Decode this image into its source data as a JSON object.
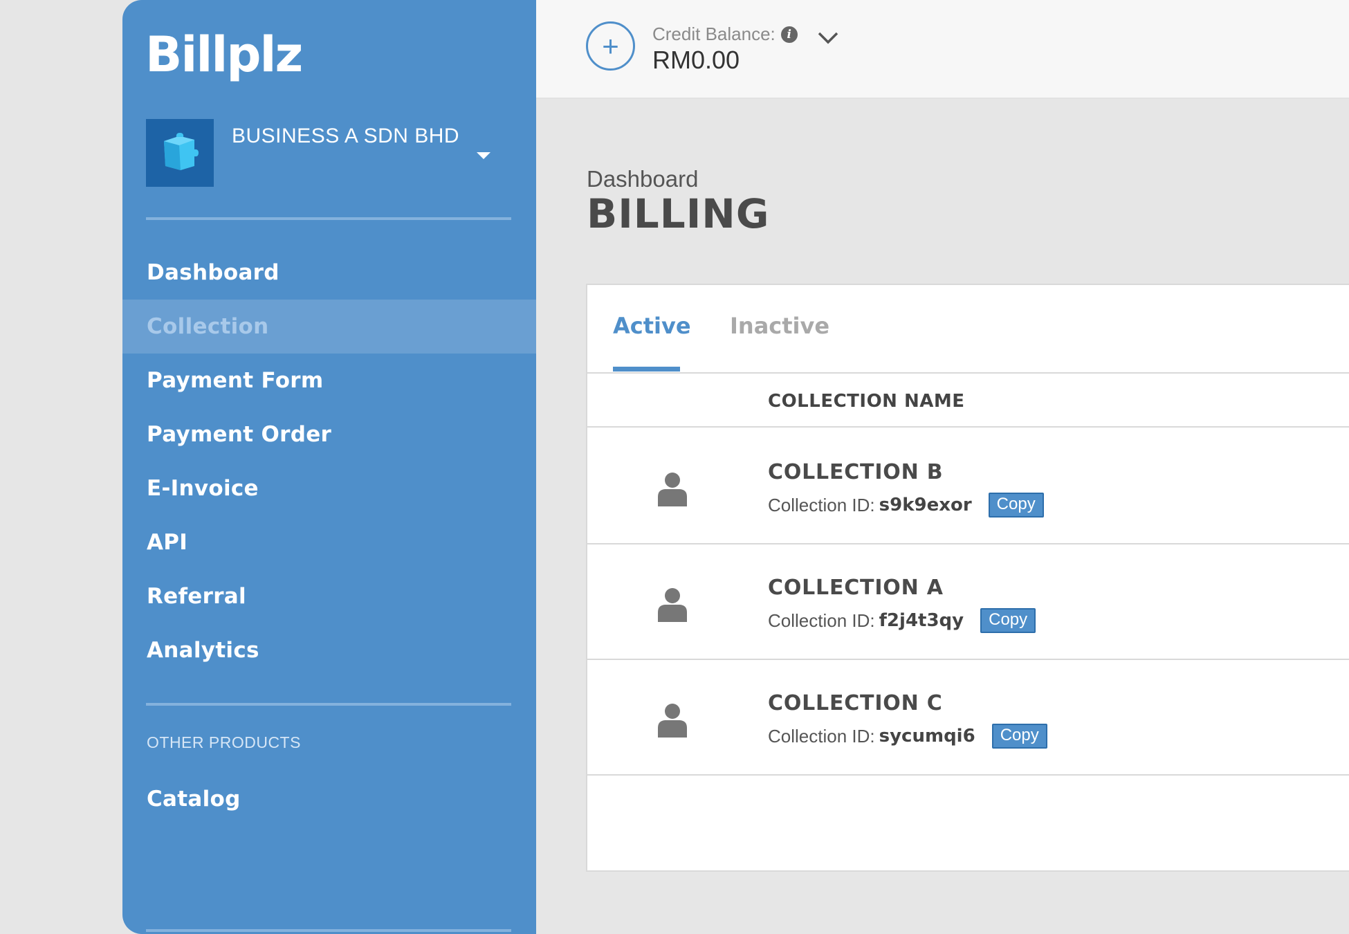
{
  "brand": {
    "logo_text": "Billplz"
  },
  "business": {
    "name": "BUSINESS A SDN BHD"
  },
  "sidebar": {
    "items": [
      {
        "label": "Dashboard"
      },
      {
        "label": "Collection"
      },
      {
        "label": "Payment Form"
      },
      {
        "label": "Payment Order"
      },
      {
        "label": "E-Invoice"
      },
      {
        "label": "API"
      },
      {
        "label": "Referral"
      },
      {
        "label": "Analytics"
      }
    ],
    "section_label": "OTHER PRODUCTS",
    "other_items": [
      {
        "label": "Catalog"
      }
    ]
  },
  "topbar": {
    "add_icon": "+",
    "credit_label": "Credit Balance:",
    "credit_value": "RM0.00"
  },
  "page": {
    "breadcrumb": "Dashboard",
    "title": "BILLING"
  },
  "tabs": [
    {
      "label": "Active"
    },
    {
      "label": "Inactive"
    }
  ],
  "table": {
    "column_header": "COLLECTION NAME",
    "id_label": "Collection ID:",
    "copy_label": "Copy",
    "rows": [
      {
        "name": "COLLECTION B",
        "id": "s9k9exor"
      },
      {
        "name": "COLLECTION A",
        "id": "f2j4t3qy"
      },
      {
        "name": "COLLECTION C",
        "id": "sycumqi6"
      }
    ]
  },
  "colors": {
    "sidebar": "#4f8fca",
    "active_nav": "#6a9fd2",
    "accent": "#4f8fca",
    "tab_inactive": "#a9a9a9"
  },
  "icons": [
    "puzzle-icon",
    "caret-down-icon",
    "plus-icon",
    "info-icon",
    "chevron-down-icon",
    "person-icon"
  ]
}
